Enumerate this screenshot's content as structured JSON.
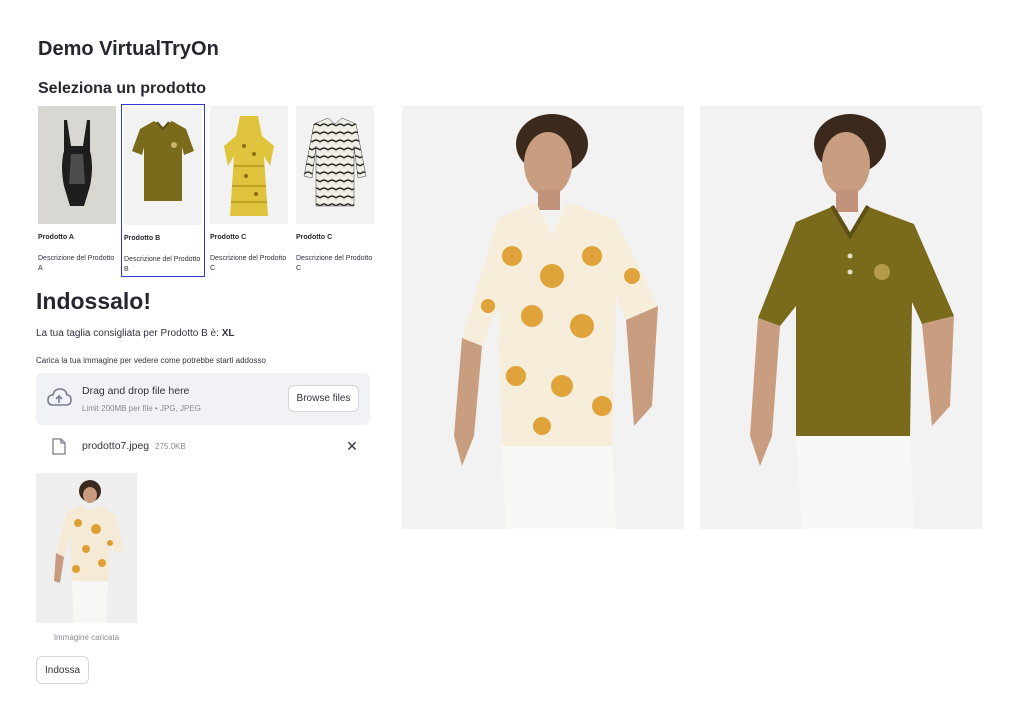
{
  "app": {
    "title": "Demo VirtualTryOn"
  },
  "catalog": {
    "heading": "Seleziona un prodotto",
    "selected_index": 1,
    "products": [
      {
        "name": "Prodotto A",
        "description": "Descrizione del Prodotto A",
        "image_icon": "lingerie-bodysuit"
      },
      {
        "name": "Prodotto B",
        "description": "Descrizione del Prodotto B",
        "image_icon": "polo-shirt"
      },
      {
        "name": "Prodotto C",
        "description": "Descrizione del Prodotto C",
        "image_icon": "yellow-dress"
      },
      {
        "name": "Prodotto C",
        "description": "Descrizione del Prodotto C",
        "image_icon": "patterned-shirt"
      }
    ]
  },
  "tryon": {
    "heading": "Indossalo!",
    "size_text": "La tua taglia consigliata per Prodotto B è: ",
    "size_value": "XL",
    "upload_hint": "Carica la tua immagine per vedere come potrebbe starti addosso"
  },
  "uploader": {
    "drop_label": "Drag and drop file here",
    "limit_label": "Limit 200MB per file • JPG, JPEG",
    "browse_label": "Browse files",
    "icon": "cloud-upload-icon"
  },
  "uploaded_file": {
    "name": "prodotto7.jpeg",
    "size": "275.0KB",
    "remove_glyph": "✕"
  },
  "uploaded_image": {
    "caption": "Immagine caricata"
  },
  "action": {
    "wear_label": "Indossa"
  },
  "colors": {
    "accent_border": "#2e3bd1",
    "dropzone_bg": "#f0f2f6",
    "polo_olive": "#7a6a1c",
    "floral_print": "#e3a63a"
  }
}
